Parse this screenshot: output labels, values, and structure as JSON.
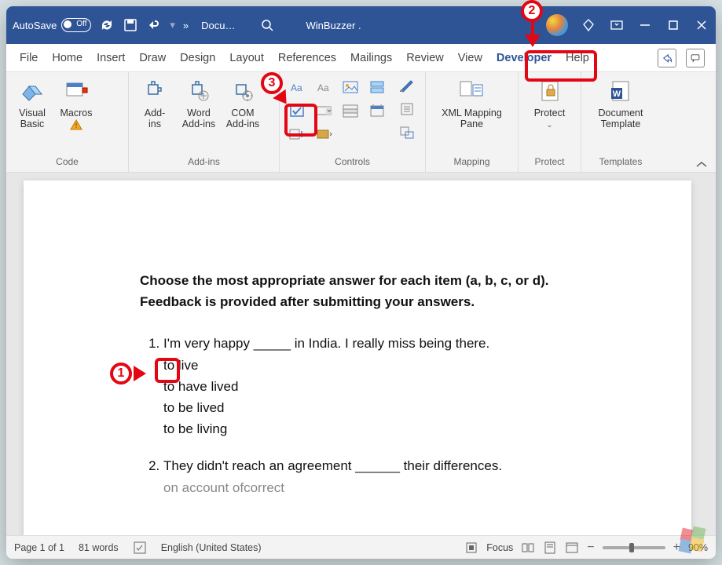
{
  "titlebar": {
    "autosave_label": "AutoSave",
    "autosave_state": "Off",
    "doc_title": "Docu…",
    "app_hint": "WinBuzzer ."
  },
  "menu": {
    "tabs": [
      "File",
      "Home",
      "Insert",
      "Draw",
      "Design",
      "Layout",
      "References",
      "Mailings",
      "Review",
      "View",
      "Developer",
      "Help"
    ],
    "active": "Developer"
  },
  "ribbon": {
    "groups": {
      "code": {
        "label": "Code",
        "items": [
          "Visual\nBasic",
          "Macros"
        ]
      },
      "addins": {
        "label": "Add-ins",
        "items": [
          "Add-\nins",
          "Word\nAdd-ins",
          "COM\nAdd-ins"
        ]
      },
      "controls": {
        "label": "Controls",
        "grid_names": [
          "rich-text",
          "plain-text",
          "picture",
          "building-block",
          "checkbox",
          "combo-box",
          "dropdown",
          "date-picker",
          "repeating",
          "group",
          "legacy-tools",
          ""
        ],
        "props_names": [
          "design-mode",
          "properties",
          "group-content"
        ]
      },
      "mapping": {
        "label": "Mapping",
        "items": [
          "XML Mapping\nPane"
        ]
      },
      "protect": {
        "label": "Protect",
        "items": [
          "Protect"
        ]
      },
      "templates": {
        "label": "Templates",
        "items": [
          "Document\nTemplate"
        ]
      }
    }
  },
  "document": {
    "intro": "Choose the most appropriate answer for each item (a, b, c, or d). Feedback is provided after submitting your answers.",
    "questions": [
      {
        "text": "I'm very happy _____ in India. I really miss being there.",
        "options": [
          "to live",
          "to have lived",
          "to be lived",
          "to be living"
        ]
      },
      {
        "text": "They didn't reach an agreement ______ their differences.",
        "partial": "on account ofcorrect"
      }
    ]
  },
  "statusbar": {
    "page": "Page 1 of 1",
    "words": "81 words",
    "language": "English (United States)",
    "focus": "Focus",
    "zoom": "90%"
  },
  "callouts": {
    "c1": "1",
    "c2": "2",
    "c3": "3"
  },
  "watermark": ""
}
